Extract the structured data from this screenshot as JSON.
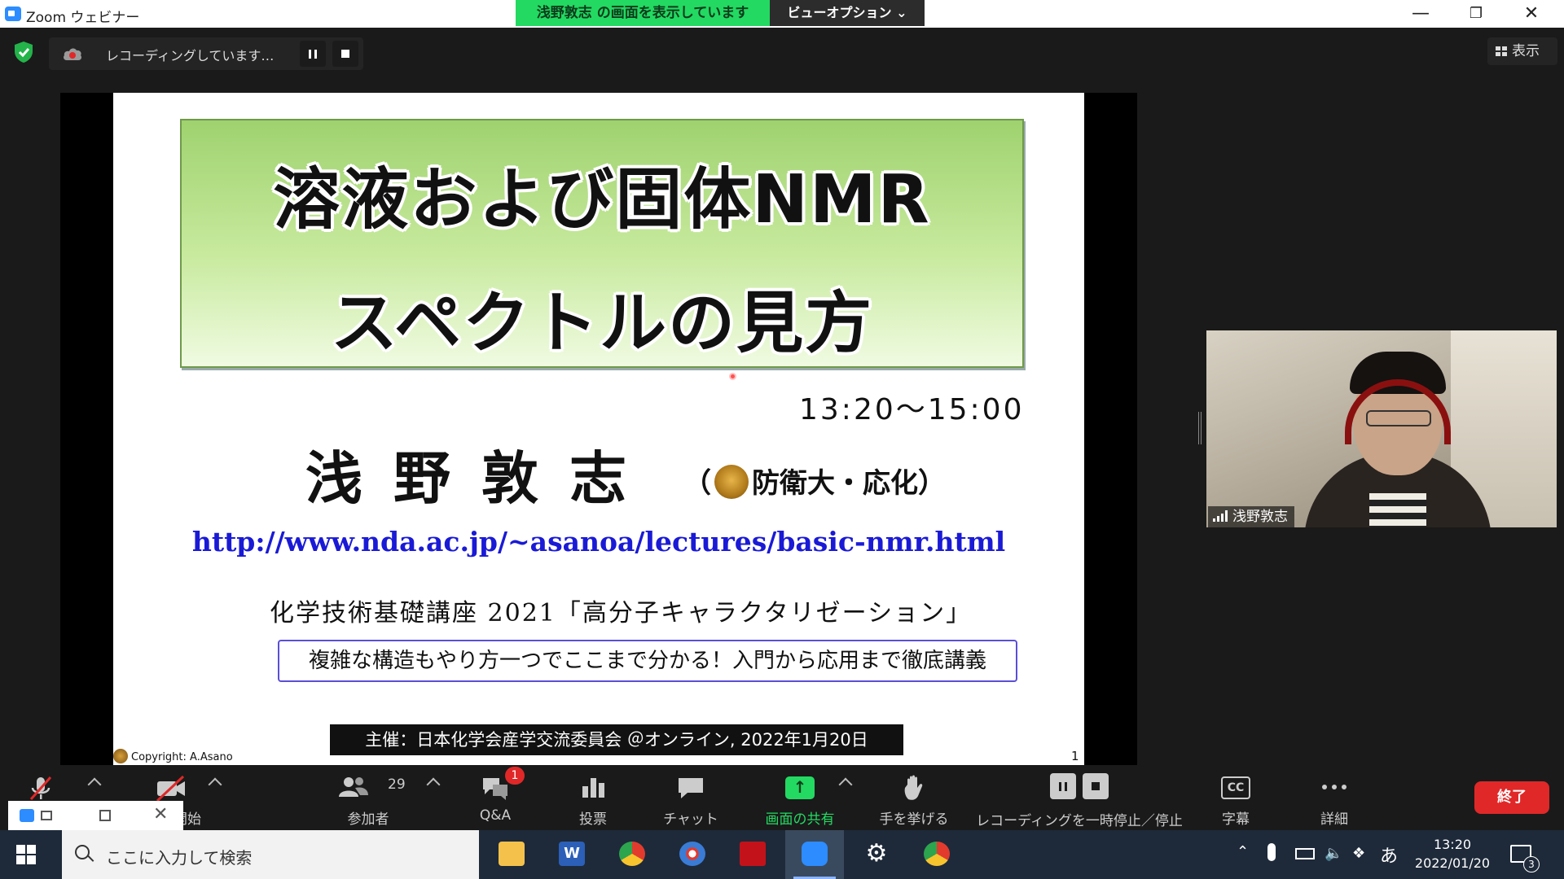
{
  "window": {
    "app_title": "Zoom ウェビナー",
    "share_banner": "浅野敦志 の画面を表示しています",
    "view_options": "ビューオプション ⌄"
  },
  "recording": {
    "status": "レコーディングしています…",
    "view_label": "表示"
  },
  "slide": {
    "title_line1": "溶液および固体NMR",
    "title_line2": "スペクトルの見方",
    "time": "13:20～15:00",
    "speaker": "浅野敦志",
    "affiliation_open": "（",
    "affiliation": "防衛大・応化）",
    "url": "http://www.nda.ac.jp/~asanoa/lectures/basic-nmr.html",
    "course": "化学技術基礎講座 2021「高分子キャラクタリゼーション」",
    "tagline": "複雑な構造もやり方一つでここまで分かる！入門から応用まで徹底講義",
    "host": "主催：日本化学会産学交流委員会 ＠オンライン, 2022年1月20日",
    "copyright": "Copyright: A.Asano",
    "page_number": "1"
  },
  "video": {
    "participant_name": "浅野敦志"
  },
  "toolbar": {
    "video_label": "開始",
    "participants_count": "29",
    "participants_label": "参加者",
    "qa_badge": "1",
    "qa_label": "Q&A",
    "poll_label": "投票",
    "chat_label": "チャット",
    "share_label": "画面の共有",
    "raise_hand_label": "手を挙げる",
    "recording_label": "レコーディングを一時停止／停止",
    "captions_label": "字幕",
    "cc_text": "CC",
    "more_label": "詳細",
    "end_label": "終了"
  },
  "taskbar": {
    "search_placeholder": "ここに入力して検索",
    "ime": "あ",
    "time": "13:20",
    "date": "2022/01/20",
    "notifications": "3"
  },
  "colors": {
    "share_green": "#23d962",
    "end_red": "#e02828",
    "url_blue": "#1a1ad6",
    "title_green": "#9fd26f"
  }
}
